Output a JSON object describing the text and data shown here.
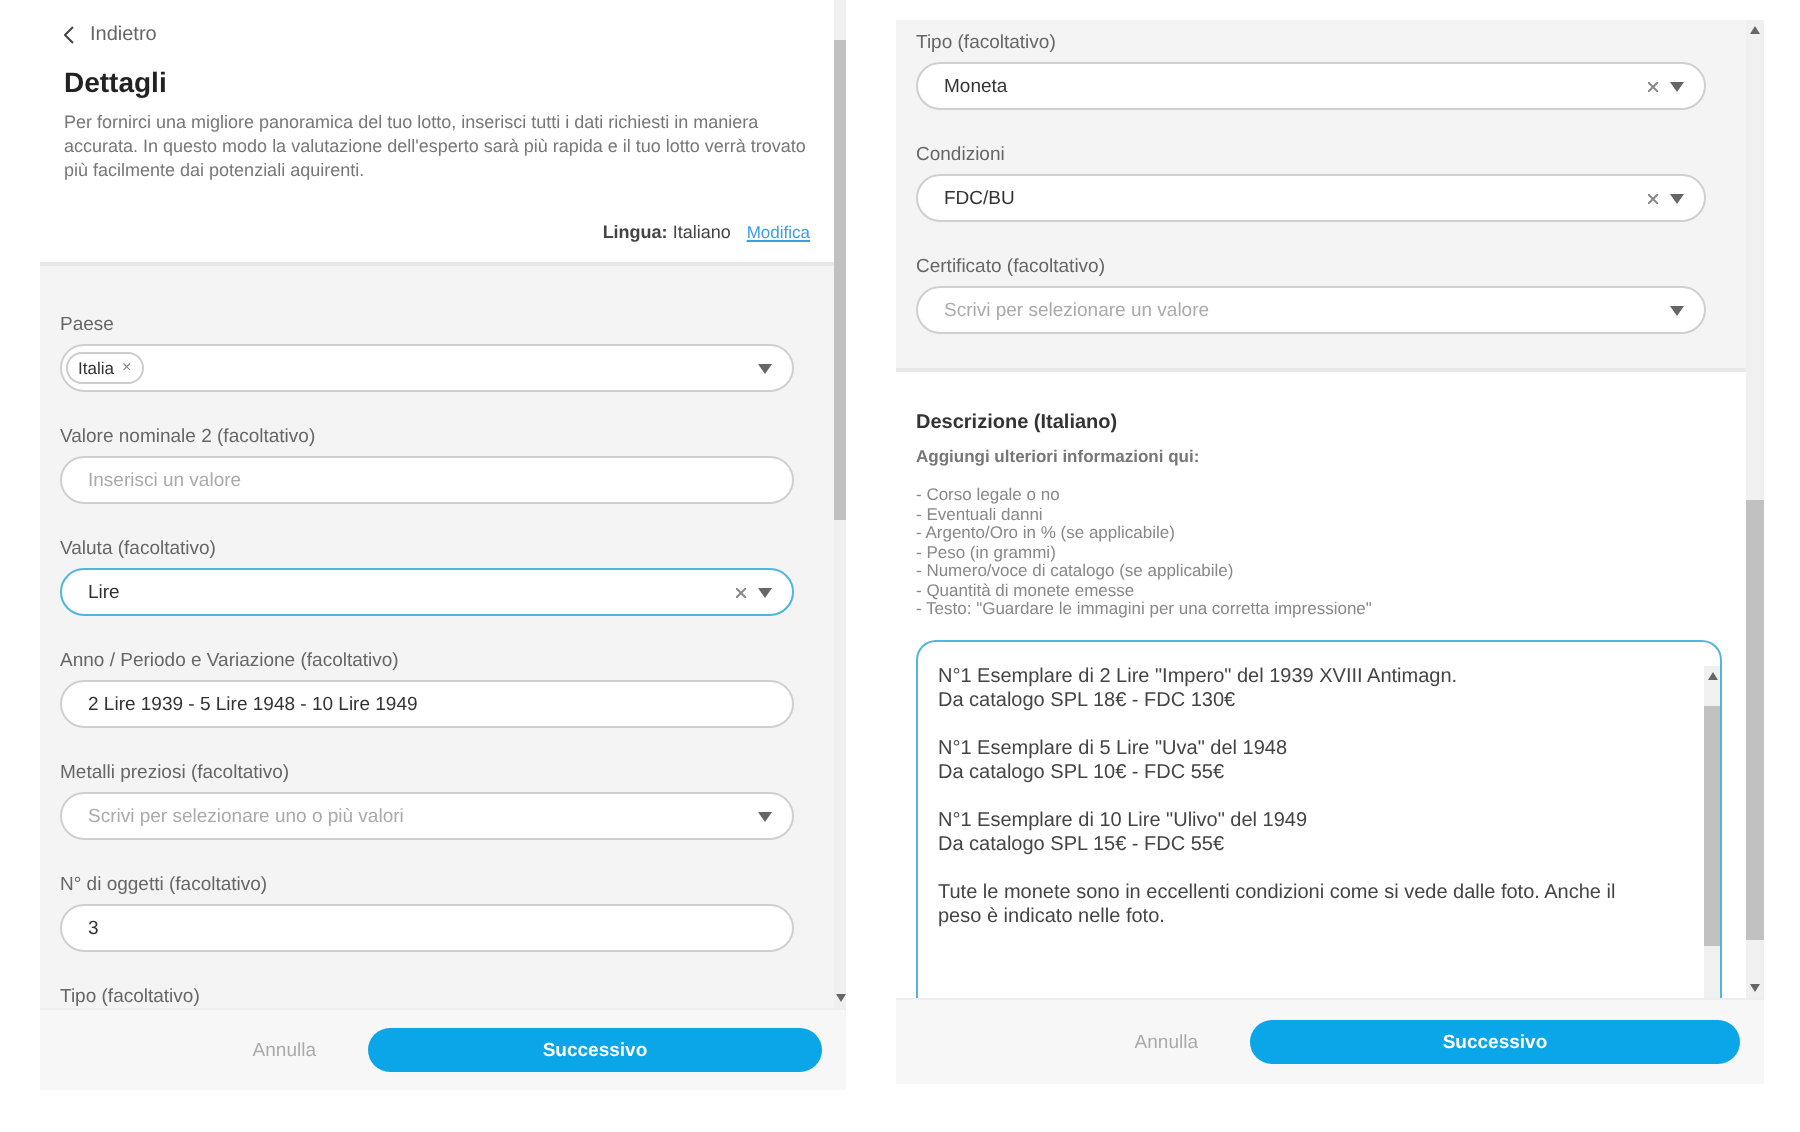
{
  "left_panel": {
    "back": "Indietro",
    "title": "Dettagli",
    "intro": "Per fornirci una migliore panoramica del tuo lotto, inserisci tutti i dati richiesti in maniera accurata. In questo modo la valutazione dell'esperto sarà più rapida e il tuo lotto verrà trovato più facilmente dai potenziali aquirenti.",
    "language": "**Lingua:** Italiano",
    "change_link": "Modifica",
    "fields": [
      {
        "label": "Paese",
        "kind": "select",
        "chips": [
          {
            "label": "Italia",
            "remove": "×"
          }
        ],
        "clearable": false,
        "focused": false
      },
      {
        "label": "Valore nominale 2 (facoltativo)",
        "kind": "text",
        "placeholder": "Inserisci un valore",
        "focused": false
      },
      {
        "label": "Valuta (facoltativo)",
        "kind": "select",
        "value": "Lire",
        "clearable": true,
        "focused": true
      },
      {
        "label": "Anno / Periodo e Variazione (facoltativo)",
        "kind": "text",
        "value": "2 Lire 1939 - 5 Lire 1948 - 10 Lire 1949",
        "focused": false
      },
      {
        "label": "Metalli preziosi (facoltativo)",
        "kind": "select",
        "placeholder": "Scrivi per selezionare uno o più valori",
        "clearable": false,
        "focused": false
      },
      {
        "label": "N° di oggetti (facoltativo)",
        "kind": "text",
        "value": "3",
        "focused": false
      },
      {
        "label": "Tipo (facoltativo)",
        "kind": "label"
      }
    ],
    "footer": {
      "cancel": "Annulla",
      "next": "Successivo"
    }
  },
  "right_panel": {
    "fields": [
      {
        "label": "Tipo (facoltativo)",
        "kind": "select",
        "value": "Moneta",
        "clearable": true,
        "focused": false
      },
      {
        "label": "Condizioni",
        "kind": "select",
        "value": "FDC/BU",
        "clearable": true,
        "focused": false
      },
      {
        "label": "Certificato (facoltativo)",
        "kind": "select",
        "placeholder": "Scrivi per selezionare un valore",
        "clearable": false,
        "focused": false
      }
    ],
    "description": {
      "title": "Descrizione (Italiano)",
      "hint_title": "Aggiungi ulteriori informazioni qui:",
      "hint_lines": [
        "- Corso legale o no",
        "- Eventuali danni",
        "- Argento/Oro in % (se applicabile)",
        "- Peso (in grammi)",
        "- Numero/voce di catalogo (se applicabile)",
        "- Quantità di monete emesse",
        "- Testo: \"Guardare le immagini per una corretta impressione\""
      ],
      "paragraphs": [
        [
          "N°1 Esemplare di 2 Lire \"Impero\" del 1939 XVIII Antimagn.",
          "Da catalogo SPL 18€ - FDC 130€"
        ],
        [
          "N°1 Esemplare di 5 Lire \"Uva\" del 1948",
          "Da catalogo SPL 10€ - FDC 55€"
        ],
        [
          "N°1 Esemplare di 10 Lire \"Ulivo\" del 1949",
          "Da catalogo SPL 15€ - FDC 55€"
        ],
        [
          "Tute le monete sono in eccellenti condizioni come si vede dalle foto. Anche il",
          "peso è indicato nelle foto."
        ]
      ],
      "focused": true
    },
    "footer": {
      "cancel": "Annulla",
      "next": "Successivo"
    }
  }
}
